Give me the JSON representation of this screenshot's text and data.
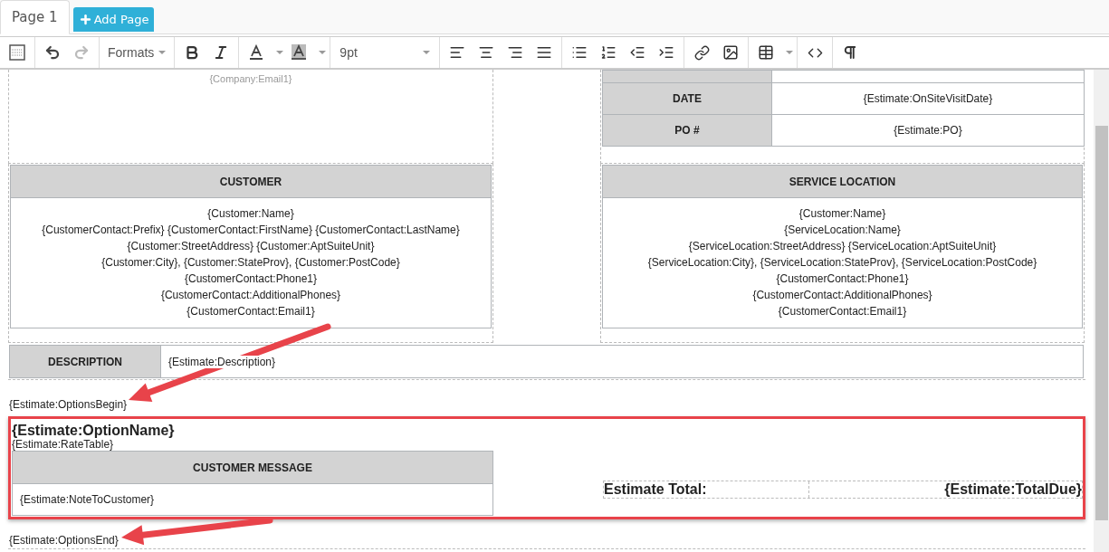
{
  "tabs": [
    {
      "label": "Page 1",
      "selected": true
    }
  ],
  "add_page_button": {
    "label": "Add Page"
  },
  "toolbar": {
    "formats": "Formats",
    "font_size": "9pt"
  },
  "document": {
    "company_email": "{Company:Email1}",
    "info_rows": [
      {
        "label": "DATE",
        "value": "{Estimate:OnSiteVisitDate}"
      },
      {
        "label": "PO #",
        "value": "{Estimate:PO}"
      }
    ],
    "address_blocks": [
      {
        "title": "CUSTOMER",
        "lines": [
          "{Customer:Name}",
          "{CustomerContact:Prefix} {CustomerContact:FirstName} {CustomerContact:LastName}",
          "{Customer:StreetAddress} {Customer:AptSuiteUnit}",
          "{Customer:City}, {Customer:StateProv}, {Customer:PostCode}",
          "{CustomerContact:Phone1}",
          "{CustomerContact:AdditionalPhones}",
          "{CustomerContact:Email1}"
        ]
      },
      {
        "title": "SERVICE LOCATION",
        "lines": [
          "{Customer:Name}",
          "{ServiceLocation:Name}",
          "{ServiceLocation:StreetAddress} {ServiceLocation:AptSuiteUnit}",
          "{ServiceLocation:City}, {ServiceLocation:StateProv}, {ServiceLocation:PostCode}",
          "{CustomerContact:Phone1}",
          "{CustomerContact:AdditionalPhones}",
          "{CustomerContact:Email1}"
        ]
      }
    ],
    "description": {
      "label": "DESCRIPTION",
      "value": "{Estimate:Description}"
    },
    "options_begin": "{Estimate:OptionsBegin}",
    "option_name": "{Estimate:OptionName}",
    "rate_table": "{Estimate:RateTable}",
    "customer_message": {
      "title": "CUSTOMER MESSAGE",
      "value": "{Estimate:NoteToCustomer}"
    },
    "total": {
      "label": "Estimate Total:",
      "value": "{Estimate:TotalDue}"
    },
    "options_end": "{Estimate:OptionsEnd}"
  }
}
